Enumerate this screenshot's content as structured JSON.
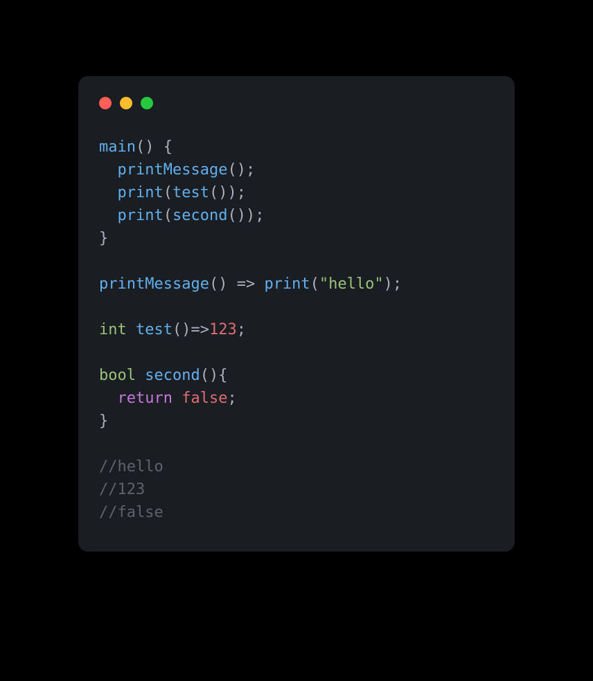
{
  "code": {
    "lines": [
      {
        "tokens": [
          {
            "text": "main",
            "cls": "c-fn"
          },
          {
            "text": "() {",
            "cls": "c-punc"
          }
        ]
      },
      {
        "tokens": [
          {
            "text": "  ",
            "cls": "c-punc"
          },
          {
            "text": "printMessage",
            "cls": "c-fn"
          },
          {
            "text": "();",
            "cls": "c-punc"
          }
        ]
      },
      {
        "tokens": [
          {
            "text": "  ",
            "cls": "c-punc"
          },
          {
            "text": "print",
            "cls": "c-fn"
          },
          {
            "text": "(",
            "cls": "c-punc"
          },
          {
            "text": "test",
            "cls": "c-fn"
          },
          {
            "text": "());",
            "cls": "c-punc"
          }
        ]
      },
      {
        "tokens": [
          {
            "text": "  ",
            "cls": "c-punc"
          },
          {
            "text": "print",
            "cls": "c-fn"
          },
          {
            "text": "(",
            "cls": "c-punc"
          },
          {
            "text": "second",
            "cls": "c-fn"
          },
          {
            "text": "());",
            "cls": "c-punc"
          }
        ]
      },
      {
        "tokens": [
          {
            "text": "}",
            "cls": "c-punc"
          }
        ]
      },
      {
        "tokens": [
          {
            "text": " ",
            "cls": "c-punc"
          }
        ]
      },
      {
        "tokens": [
          {
            "text": "printMessage",
            "cls": "c-fn"
          },
          {
            "text": "() => ",
            "cls": "c-punc"
          },
          {
            "text": "print",
            "cls": "c-fn"
          },
          {
            "text": "(",
            "cls": "c-punc"
          },
          {
            "text": "\"hello\"",
            "cls": "c-str"
          },
          {
            "text": ");",
            "cls": "c-punc"
          }
        ]
      },
      {
        "tokens": [
          {
            "text": " ",
            "cls": "c-punc"
          }
        ]
      },
      {
        "tokens": [
          {
            "text": "int",
            "cls": "c-type"
          },
          {
            "text": " ",
            "cls": "c-punc"
          },
          {
            "text": "test",
            "cls": "c-fn"
          },
          {
            "text": "()=>",
            "cls": "c-punc"
          },
          {
            "text": "123",
            "cls": "c-bool"
          },
          {
            "text": ";",
            "cls": "c-punc"
          }
        ]
      },
      {
        "tokens": [
          {
            "text": " ",
            "cls": "c-punc"
          }
        ]
      },
      {
        "tokens": [
          {
            "text": "bool",
            "cls": "c-type"
          },
          {
            "text": " ",
            "cls": "c-punc"
          },
          {
            "text": "second",
            "cls": "c-fn"
          },
          {
            "text": "(){",
            "cls": "c-punc"
          }
        ]
      },
      {
        "tokens": [
          {
            "text": "  ",
            "cls": "c-punc"
          },
          {
            "text": "return",
            "cls": "c-kw"
          },
          {
            "text": " ",
            "cls": "c-punc"
          },
          {
            "text": "false",
            "cls": "c-bool"
          },
          {
            "text": ";",
            "cls": "c-punc"
          }
        ]
      },
      {
        "tokens": [
          {
            "text": "}",
            "cls": "c-punc"
          }
        ]
      },
      {
        "tokens": [
          {
            "text": " ",
            "cls": "c-punc"
          }
        ]
      },
      {
        "tokens": [
          {
            "text": "//hello",
            "cls": "c-comment"
          }
        ]
      },
      {
        "tokens": [
          {
            "text": "//123",
            "cls": "c-comment"
          }
        ]
      },
      {
        "tokens": [
          {
            "text": "//false",
            "cls": "c-comment"
          }
        ]
      }
    ]
  }
}
